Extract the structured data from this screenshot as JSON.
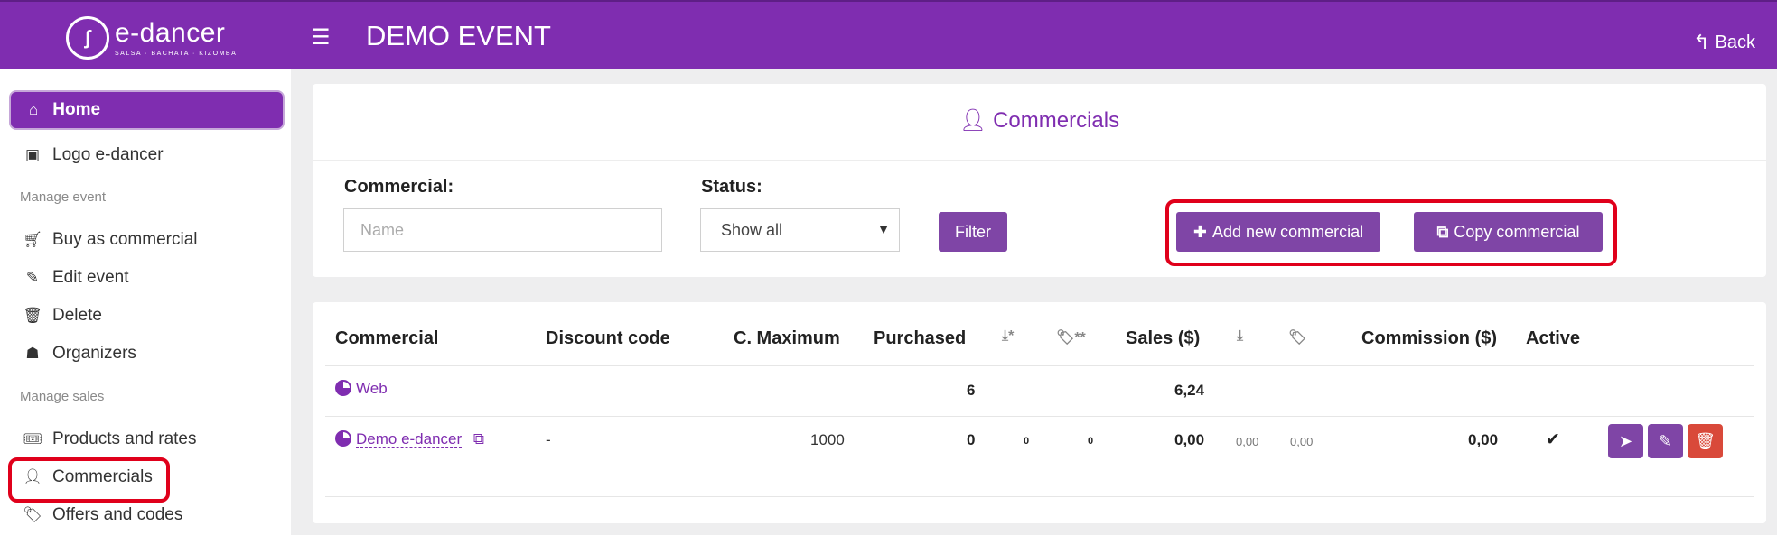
{
  "header": {
    "logo_title": "e-dancer",
    "logo_sub": "SALSA · BACHATA · KIZOMBA",
    "event_title": "DEMO EVENT",
    "back_label": "Back",
    "color": "#7f2db0"
  },
  "sidebar": {
    "home": "Home",
    "logo_item": "Logo e-dancer",
    "section_event": "Manage event",
    "event_items": [
      "Buy as commercial",
      "Edit event",
      "Delete",
      "Organizers"
    ],
    "section_sales": "Manage sales",
    "sales_items": [
      "Products and rates",
      "Commercials",
      "Offers and codes"
    ]
  },
  "filter": {
    "title": "Commercials",
    "commercial_label": "Commercial:",
    "name_placeholder": "Name",
    "status_label": "Status:",
    "status_value": "Show all",
    "filter_button": "Filter",
    "add_button": "Add new commercial",
    "copy_button": "Copy commercial"
  },
  "table": {
    "headers": {
      "commercial": "Commercial",
      "discount_code": "Discount code",
      "c_maximum": "C. Maximum",
      "purchased": "Purchased",
      "dl_star": "*",
      "tag_star": "**",
      "sales": "Sales ($)",
      "commission": "Commission ($)",
      "active": "Active"
    },
    "rows": [
      {
        "commercial": "Web",
        "discount_code": "",
        "c_maximum": "",
        "purchased": "6",
        "dl": "",
        "tag": "",
        "sales": "6,24",
        "sales_dl": "",
        "sales_tag": "",
        "commission": "",
        "active": ""
      },
      {
        "commercial": "Demo e-dancer",
        "discount_code": "-",
        "c_maximum": "1000",
        "purchased": "0",
        "dl": "0",
        "tag": "0",
        "sales": "0,00",
        "sales_dl": "0,00",
        "sales_tag": "0,00",
        "commission": "0,00",
        "active": "✔"
      }
    ]
  }
}
